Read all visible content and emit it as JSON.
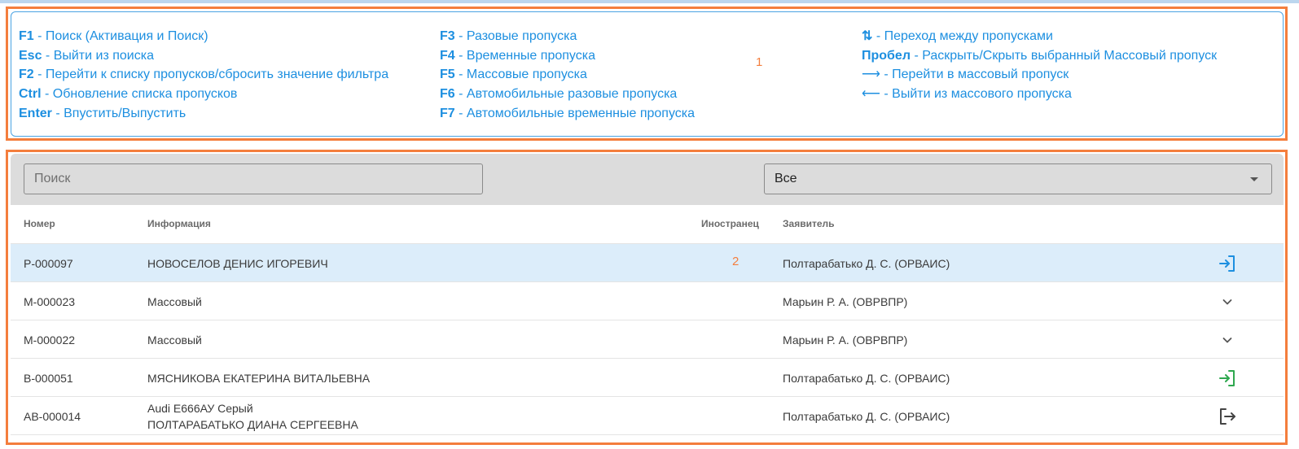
{
  "annotations": {
    "frame1_number": "1",
    "frame2_number": "2"
  },
  "shortcuts": {
    "col1": [
      {
        "key": "F1",
        "desc": " - Поиск (Активация и Поиск)"
      },
      {
        "key": "Esc",
        "desc": " - Выйти из поиска"
      },
      {
        "key": "F2",
        "desc": " - Перейти к списку пропусков/сбросить значение фильтра"
      },
      {
        "key": "Ctrl",
        "desc": " - Обновление списка пропусков"
      },
      {
        "key": "Enter",
        "desc": " - Впустить/Выпустить"
      }
    ],
    "col2": [
      {
        "key": "F3",
        "desc": " - Разовые пропуска"
      },
      {
        "key": "F4",
        "desc": " - Временные пропуска"
      },
      {
        "key": "F5",
        "desc": " - Массовые пропуска"
      },
      {
        "key": "F6",
        "desc": " - Автомобильные разовые пропуска"
      },
      {
        "key": "F7",
        "desc": " - Автомобильные временные пропуска"
      }
    ],
    "col3": [
      {
        "key": "⇅",
        "desc": " - Переход между пропусками"
      },
      {
        "key": "Пробел",
        "desc": " - Раскрыть/Скрыть выбранный Массовый пропуск"
      },
      {
        "key": "⟶",
        "desc": " - Перейти в массовый пропуск"
      },
      {
        "key": "⟵",
        "desc": " - Выйти из массового пропуска"
      }
    ]
  },
  "filter": {
    "search_placeholder": "Поиск",
    "search_value": "",
    "type_selected": "Все"
  },
  "table": {
    "headers": {
      "number": "Номер",
      "info": "Информация",
      "foreigner": "Иностранец",
      "applicant": "Заявитель"
    },
    "rows": [
      {
        "number": "Р-000097",
        "info_line1": "НОВОСЕЛОВ ДЕНИС ИГОРЕВИЧ",
        "info_line2": "",
        "foreigner": "",
        "applicant": "Полтарабатько Д. С. (ОРВАИС)",
        "action_icon": "enter-icon",
        "action_color": "#1d8fe0"
      },
      {
        "number": "М-000023",
        "info_line1": "Массовый",
        "info_line2": "",
        "foreigner": "",
        "applicant": "Марьин Р. А. (ОВРВПР)",
        "action_icon": "chevron-down-icon",
        "action_color": "#555555"
      },
      {
        "number": "М-000022",
        "info_line1": "Массовый",
        "info_line2": "",
        "foreigner": "",
        "applicant": "Марьин Р. А. (ОВРВПР)",
        "action_icon": "chevron-down-icon",
        "action_color": "#555555"
      },
      {
        "number": "В-000051",
        "info_line1": "МЯСНИКОВА ЕКАТЕРИНА ВИТАЛЬЕВНА",
        "info_line2": "",
        "foreigner": "",
        "applicant": "Полтарабатько Д. С. (ОРВАИС)",
        "action_icon": "enter-icon",
        "action_color": "#2fa84f"
      },
      {
        "number": "АВ-000014",
        "info_line1": "Audi Е666АУ Серый",
        "info_line2": "ПОЛТАРАБАТЬКО ДИАНА СЕРГЕЕВНА",
        "foreigner": "",
        "applicant": "Полтарабатько Д. С. (ОРВАИС)",
        "action_icon": "exit-icon",
        "action_color": "#444444"
      }
    ]
  },
  "colors": {
    "accent": "#1d8fe0",
    "annotation": "#f47e3d",
    "selected_row": "#dcedfa",
    "filter_bg": "#dcdcdc"
  }
}
